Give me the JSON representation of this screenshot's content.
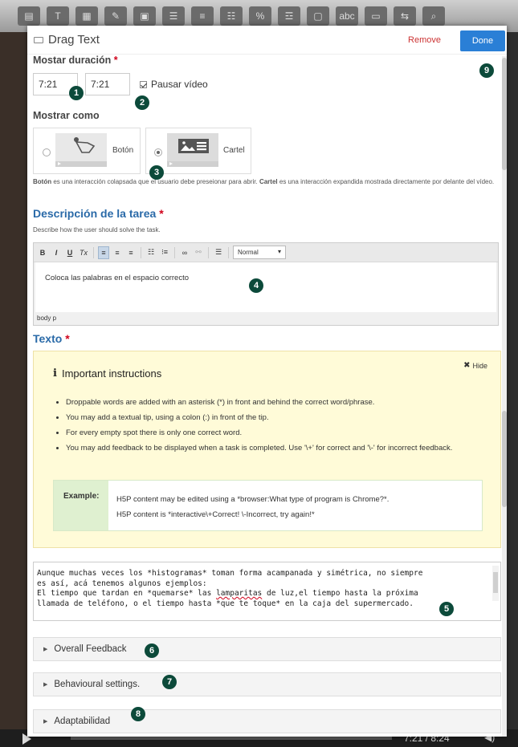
{
  "background": {
    "toolbar_icons": [
      "text-icon",
      "table-icon",
      "link-icon",
      "image-icon",
      "list-icon",
      "numbered-list-icon",
      "checklist-icon",
      "percent-icon",
      "fill-blanks-icon",
      "video-icon",
      "drag-text-icon",
      "board-icon",
      "split-icon",
      "search-icon"
    ],
    "toolbar_glyphs": [
      "▤",
      "T",
      "▦",
      "✎",
      "▣",
      "☰",
      "≡",
      "☷",
      "%",
      "☲",
      "▢",
      "abc",
      "▭",
      "⇆",
      "⌕"
    ],
    "player_time": "7:21 / 8:24"
  },
  "dialog": {
    "title": "Drag Text",
    "remove_label": "Remove",
    "done_label": "Done"
  },
  "duration": {
    "label": "Mostar duración",
    "from_value": "7:21",
    "to_value": "7:21",
    "pause_label": "Pausar vídeo",
    "pause_checked": true
  },
  "display_as": {
    "label": "Mostrar como",
    "options": [
      {
        "label": "Botón",
        "selected": false
      },
      {
        "label": "Cartel",
        "selected": true
      }
    ],
    "description_bold_1": "Botón",
    "description_1": " es una interacción colapsada que el usuario debe preseionar para abrir. ",
    "description_bold_2": "Cartel",
    "description_2": " es una interacción expandida mostrada directamente por delante del vídeo."
  },
  "task": {
    "label": "Descripción de la tarea",
    "help": "Describe how the user should solve the task.",
    "toolbar": {
      "bold": "B",
      "italic": "I",
      "underline": "U",
      "clear": "Tx",
      "align_left": "≡",
      "align_center": "≡",
      "align_right": "≡",
      "bullets": "☷",
      "numbers": "⁝≡",
      "link": "∞",
      "unlink": "⚯",
      "hr": "☰",
      "format": "Normal"
    },
    "content": "Coloca las palabras en el espacio correcto",
    "path": "body  p"
  },
  "text": {
    "label": "Texto",
    "instructions": {
      "title": "Important instructions",
      "hide_label": "Hide",
      "bullets": [
        "Droppable words are added with an asterisk (*) in front and behind the correct word/phrase.",
        "You may add a textual tip, using a colon (:) in front of the tip.",
        "For every empty spot there is only one correct word.",
        "You may add feedback to be displayed when a task is completed. Use '\\+' for correct and '\\-' for incorrect feedback."
      ],
      "example_label": "Example:",
      "example_line_1": "H5P content may be edited using a *browser:What type of program is Chrome?*.",
      "example_line_2": "H5P content is *interactive\\+Correct! \\-Incorrect, try again!*"
    },
    "content_a": "Aunque muchas veces los *histogramas* toman forma acampanada y simétrica, no siempre\nes así, acá tenemos algunos ejemplos:\nEl tiempo que tardan en *quemarse* las ",
    "content_misspelled": "lamparitas",
    "content_b": " de luz,el tiempo hasta la próxima\nllamada de teléfono, o el tiempo hasta *que te toque* en la caja del supermercado."
  },
  "sections": [
    {
      "label": "Overall Feedback"
    },
    {
      "label": "Behavioural settings."
    },
    {
      "label": "Adaptabilidad"
    }
  ],
  "badges": [
    "1",
    "2",
    "3",
    "4",
    "5",
    "6",
    "7",
    "8",
    "9"
  ],
  "colors": {
    "accent_blue": "#2a7fd6",
    "label_blue": "#2a6aa8",
    "required_red": "#d0021b",
    "badge": "#0c4a3a",
    "instructions_bg": "#fffbd8",
    "example_bg": "#dff0d0"
  }
}
